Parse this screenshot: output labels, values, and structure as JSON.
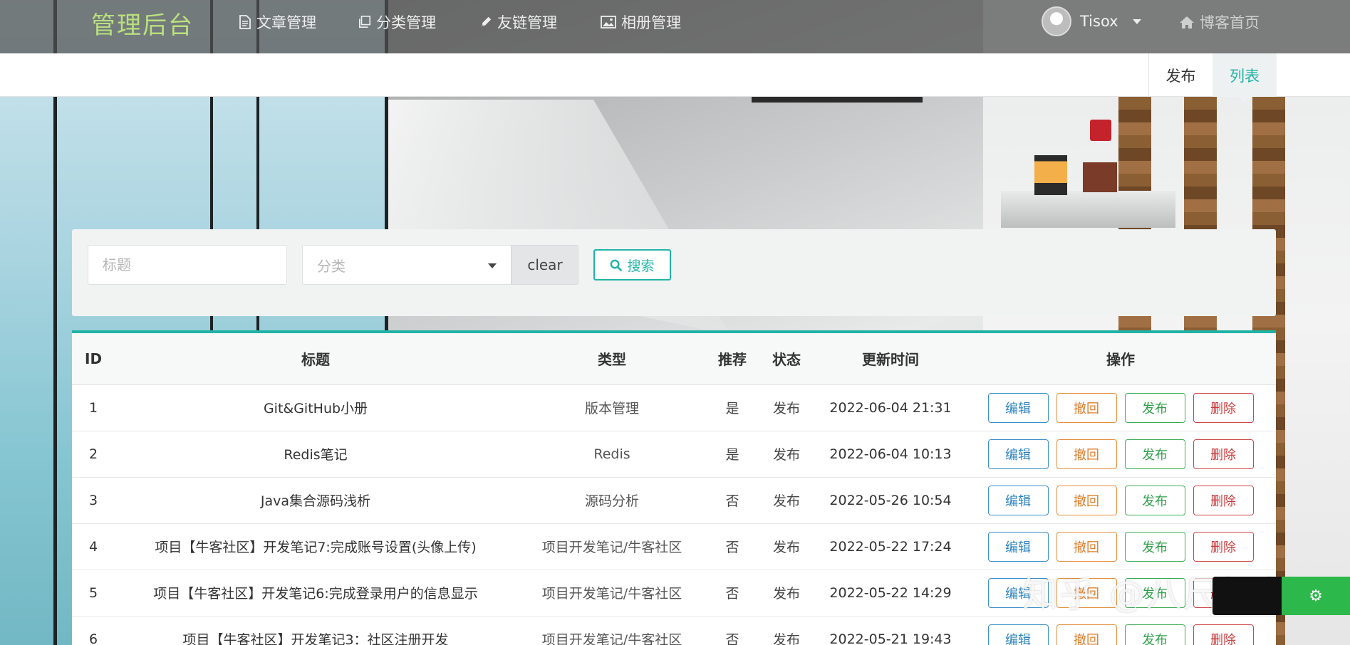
{
  "navbar": {
    "brand": "管理后台",
    "items": [
      {
        "label": "文章管理",
        "icon": "file-icon"
      },
      {
        "label": "分类管理",
        "icon": "copy-icon"
      },
      {
        "label": "友链管理",
        "icon": "pencil-icon"
      },
      {
        "label": "相册管理",
        "icon": "image-icon"
      }
    ],
    "user": {
      "name": "Tisox"
    },
    "home_link": "博客首页"
  },
  "subbar": {
    "tabs": [
      {
        "label": "发布",
        "active": false
      },
      {
        "label": "列表",
        "active": true
      }
    ]
  },
  "search": {
    "title_placeholder": "标题",
    "category_placeholder": "分类",
    "clear_label": "clear",
    "search_label": "搜索"
  },
  "table": {
    "headers": [
      "ID",
      "标题",
      "类型",
      "推荐",
      "状态",
      "更新时间",
      "操作"
    ],
    "rows": [
      {
        "id": "1",
        "title": "Git&GitHub小册",
        "category": "版本管理",
        "recommend": "是",
        "status": "发布",
        "updated": "2022-06-04 21:31"
      },
      {
        "id": "2",
        "title": "Redis笔记",
        "category": "Redis",
        "recommend": "是",
        "status": "发布",
        "updated": "2022-06-04 10:13"
      },
      {
        "id": "3",
        "title": "Java集合源码浅析",
        "category": "源码分析",
        "recommend": "否",
        "status": "发布",
        "updated": "2022-05-26 10:54"
      },
      {
        "id": "4",
        "title": "项目【牛客社区】开发笔记7:完成账号设置(头像上传)",
        "category": "项目开发笔记/牛客社区",
        "recommend": "否",
        "status": "发布",
        "updated": "2022-05-22 17:24"
      },
      {
        "id": "5",
        "title": "项目【牛客社区】开发笔记6:完成登录用户的信息显示",
        "category": "项目开发笔记/牛客社区",
        "recommend": "否",
        "status": "发布",
        "updated": "2022-05-22 14:29"
      },
      {
        "id": "6",
        "title": "项目【牛客社区】开发笔记3：社区注册开发",
        "category": "项目开发笔记/牛客社区",
        "recommend": "否",
        "status": "发布",
        "updated": "2022-05-21 19:43"
      }
    ],
    "actions": {
      "edit": "编辑",
      "revoke": "撤回",
      "publish": "发布",
      "delete": "删除"
    }
  },
  "watermark": "知乎 @八尺妖剑",
  "colors": {
    "accent": "#21b4a6",
    "brand": "#b9e07e",
    "edit": "#2f84bf",
    "revoke": "#dc7f2c",
    "publish": "#2f9f49",
    "delete": "#c83a3a"
  }
}
